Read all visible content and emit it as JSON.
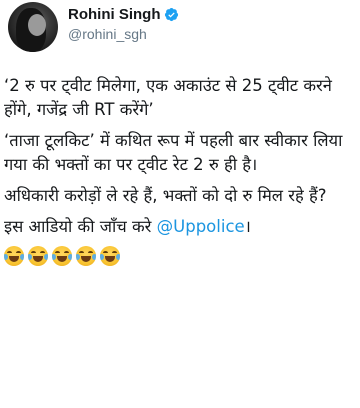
{
  "author": {
    "display_name": "Rohini Singh",
    "handle": "@rohini_sgh",
    "verified": true,
    "avatar": "profile-photo"
  },
  "tweet": {
    "paragraphs": [
      "‘2 रु पर ट्वीट मिलेगा, एक अकाउंट से 25 ट्वीट करने होंगे, गजेंद्र जी RT करेंगे’",
      "‘ताजा टूलकिट’ में कथित रूप में पहली बार स्वीकार लिया गया की भक्तों का पर ट्वीट रेट 2 रु ही है।",
      "अधिकारी करोड़ों ले रहे हैं, भक्तों को दो रु मिल रहे हैं?"
    ],
    "last_paragraph_prefix": "इस आडियो की जाँच करे ",
    "mention": "@Uppolice",
    "last_paragraph_suffix": "।",
    "emojis": [
      "face-with-tears-of-joy",
      "face-with-tears-of-joy",
      "face-with-tears-of-joy",
      "face-with-tears-of-joy",
      "face-with-tears-of-joy"
    ]
  },
  "colors": {
    "text": "#14171a",
    "secondary": "#657786",
    "link": "#1b95e0",
    "verified": "#1da1f2"
  }
}
